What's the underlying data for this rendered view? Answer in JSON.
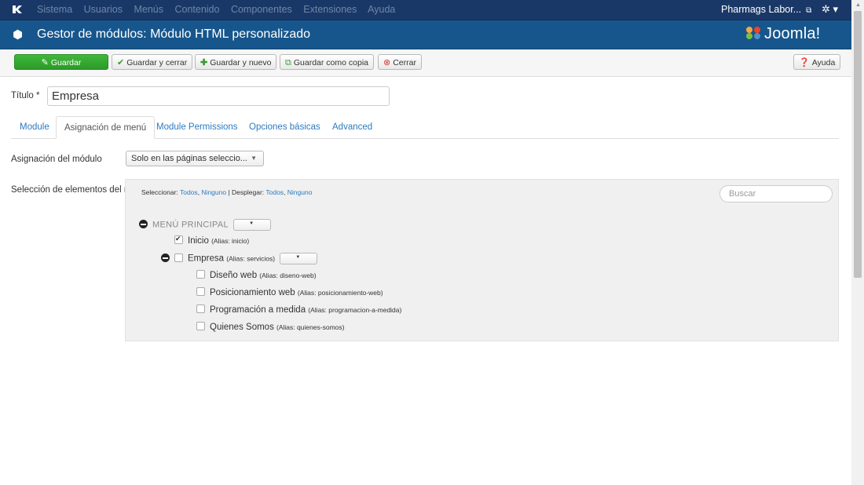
{
  "topbar": {
    "menu": [
      "Sistema",
      "Usuarios",
      "Menús",
      "Contenido",
      "Componentes",
      "Extensiones",
      "Ayuda"
    ],
    "site": "Pharmags Labor...",
    "gear_symbol": "✲ ▾"
  },
  "header": {
    "title": "Gestor de módulos: Módulo HTML personalizado",
    "brand": "Joomla!"
  },
  "toolbar": {
    "save": "Guardar",
    "save_close": "Guardar y cerrar",
    "save_new": "Guardar y nuevo",
    "save_copy": "Guardar como copia",
    "close": "Cerrar",
    "help": "Ayuda"
  },
  "form": {
    "title_label": "Título *",
    "title_value": "Empresa"
  },
  "tabs": [
    "Module",
    "Asignación de menú",
    "Module Permissions",
    "Opciones básicas",
    "Advanced"
  ],
  "assignment": {
    "label": "Asignación del módulo",
    "value": "Solo en las páginas seleccio..."
  },
  "menu_selection": {
    "label": "Selección de elementos del menú:",
    "select_prefix": "Seleccionar:",
    "all": "Todos",
    "none": "Ninguno",
    "expand_prefix": "Desplegar:",
    "search_placeholder": "Buscar",
    "root": "MENÚ PRINCIPAL",
    "items": [
      {
        "label": "Inicio",
        "alias": "(Alias: inicio)",
        "checked": true
      },
      {
        "label": "Empresa",
        "alias": "(Alias: servicios)",
        "checked": false
      },
      {
        "label": "Diseño web",
        "alias": "(Alias: diseno-web)",
        "checked": false
      },
      {
        "label": "Posicionamiento web",
        "alias": "(Alias: posicionamiento-web)",
        "checked": false
      },
      {
        "label": "Programación a medida",
        "alias": "(Alias: programacion-a-medida)",
        "checked": false
      },
      {
        "label": "Quienes Somos",
        "alias": "(Alias: quienes-somos)",
        "checked": false
      }
    ]
  },
  "colors": {
    "topbar": "#1a3867",
    "header": "#17568c",
    "save_button": "#34a831",
    "link": "#2b7bc1"
  }
}
